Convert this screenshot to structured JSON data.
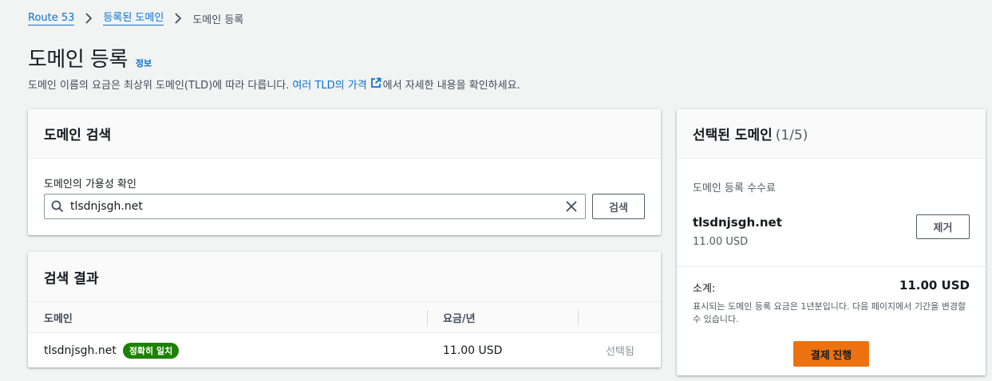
{
  "breadcrumb": {
    "items": [
      "Route 53",
      "등록된 도메인"
    ],
    "current": "도메인 등록"
  },
  "header": {
    "title": "도메인 등록",
    "info_label": "정보",
    "description_before": "도메인 이름의 요금은 최상위 도메인(TLD)에 따라 다릅니다.",
    "description_link": "여러 TLD의 가격",
    "description_after": "에서 자세한 내용을 확인하세요."
  },
  "search": {
    "title": "도메인 검색",
    "field_label": "도메인의 가용성 확인",
    "value": "tlsdnjsgh.net",
    "button_label": "검색"
  },
  "results": {
    "title": "검색 결과",
    "columns": [
      "도메인",
      "요금/년"
    ],
    "rows": [
      {
        "domain": "tlsdnjsgh.net",
        "badge": "정확히 일치",
        "price": "11.00 USD",
        "action": "선택됨"
      }
    ]
  },
  "selected": {
    "title": "선택된 도메인",
    "count": "(1/5)",
    "fee_label": "도메인 등록 수수료",
    "domain": "tlsdnjsgh.net",
    "price": "11.00 USD",
    "remove_label": "제거",
    "subtotal_label": "소계:",
    "subtotal_value": "11.00 USD",
    "note": "표시되는 도메인 등록 요금은 1년분입니다. 다음 페이지에서 기간을 변경할 수 있습니다.",
    "checkout_label": "결제 진행"
  },
  "colors": {
    "link": "#0972d3",
    "badge_success": "#1d8102",
    "primary_button": "#ec7211"
  },
  "icons": [
    "chevron-right-icon",
    "external-link-icon",
    "search-icon",
    "close-icon"
  ]
}
